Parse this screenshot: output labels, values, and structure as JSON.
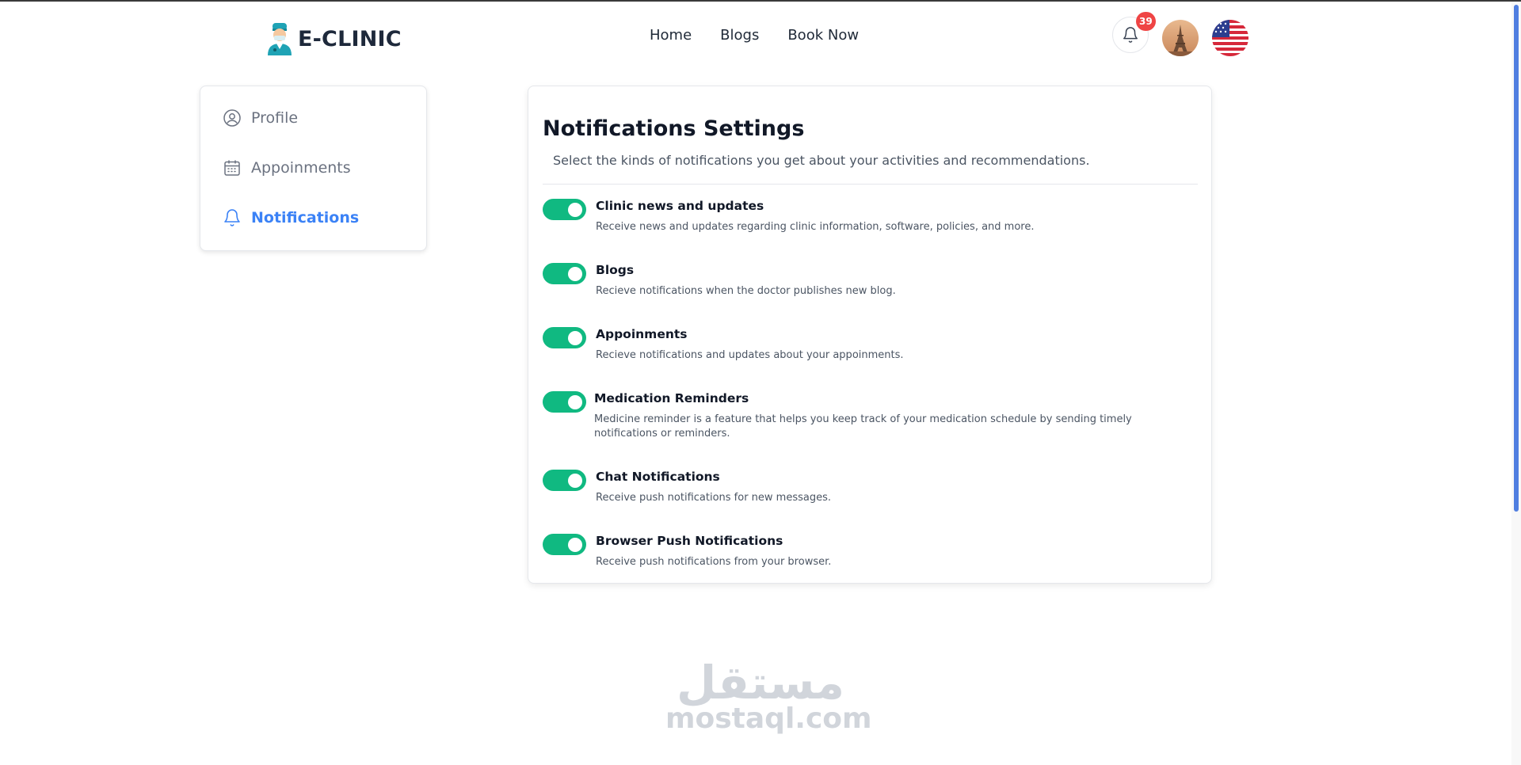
{
  "brand": {
    "name": "E-CLINIC"
  },
  "nav": {
    "items": [
      "Home",
      "Blogs",
      "Book Now"
    ]
  },
  "header": {
    "notification_count": "39"
  },
  "sidebar": {
    "items": [
      {
        "label": "Profile",
        "icon": "user-circle-icon"
      },
      {
        "label": "Appoinments",
        "icon": "calendar-icon"
      },
      {
        "label": "Notifications",
        "icon": "bell-icon",
        "active": true
      }
    ]
  },
  "main": {
    "title": "Notifications Settings",
    "subtitle": "Select the kinds of notifications you get about your activities and recommendations.",
    "settings": [
      {
        "title": "Clinic news and updates",
        "description": "Receive news and updates regarding clinic information, software, policies, and more.",
        "enabled": true
      },
      {
        "title": "Blogs",
        "description": "Recieve notifications when the doctor publishes new blog.",
        "enabled": true
      },
      {
        "title": "Appoinments",
        "description": "Recieve notifications and updates about your appoinments.",
        "enabled": true
      },
      {
        "title": "Medication Reminders",
        "description": "Medicine reminder is a feature that helps you keep track of your medication schedule by sending timely notifications or reminders.",
        "enabled": true
      },
      {
        "title": "Chat Notifications",
        "description": "Receive push notifications for new messages.",
        "enabled": true
      },
      {
        "title": "Browser Push Notifications",
        "description": "Receive push notifications from your browser.",
        "enabled": true
      }
    ]
  },
  "watermark": {
    "arabic": "مستقل",
    "latin": "mostaql.com"
  },
  "colors": {
    "accent": "#3b82f6",
    "toggle_on": "#10b981",
    "badge": "#ef4444"
  }
}
